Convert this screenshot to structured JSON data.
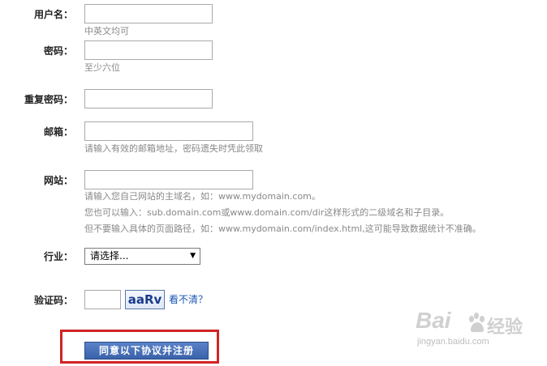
{
  "form": {
    "username": {
      "label": "用户名：",
      "value": "",
      "hint": "中英文均可"
    },
    "password": {
      "label": "密码：",
      "value": "",
      "hint": "至少六位"
    },
    "confirm_password": {
      "label": "重复密码：",
      "value": ""
    },
    "email": {
      "label": "邮箱：",
      "value": "",
      "hint": "请输入有效的邮箱地址，密码遗失时凭此领取"
    },
    "website": {
      "label": "网站：",
      "value": "",
      "hints": [
        "请输入您自己网站的主域名，如：www.mydomain.com。",
        "您也可以输入：sub.domain.com或www.domain.com/dir这样形式的二级域名和子目录。",
        "但不要输入具体的页面路径，如：www.mydomain.com/index.html,这可能导致数据统计不准确。"
      ]
    },
    "industry": {
      "label": "行业：",
      "selected": "请选择..."
    },
    "captcha": {
      "label": "验证码：",
      "value": "",
      "image_text": "aaRv",
      "refresh_label": "看不清？"
    },
    "submit_label": "同意以下协议并注册"
  },
  "watermark": {
    "brand_latin": "Bai",
    "brand_cn": "经验",
    "url": "jingyan.baidu.com"
  },
  "colors": {
    "link": "#1a55b3",
    "button": "#3a62aa",
    "highlight_frame": "#d02424",
    "hint_text": "#888888"
  }
}
